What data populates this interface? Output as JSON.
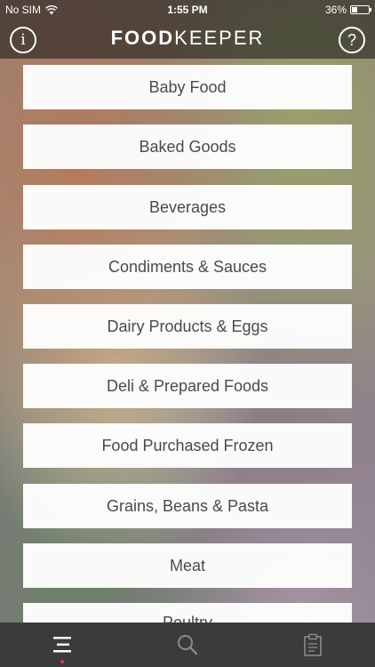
{
  "status_bar": {
    "carrier": "No SIM",
    "time": "1:55 PM",
    "battery": "36%",
    "battery_level": 0.36
  },
  "nav": {
    "logo_bold": "FOOD",
    "logo_light": "KEEPER",
    "info_icon": "info-icon",
    "help_icon": "help-icon"
  },
  "categories": [
    "Baby Food",
    "Baked Goods",
    "Beverages",
    "Condiments & Sauces",
    "Dairy Products & Eggs",
    "Deli & Prepared Foods",
    "Food Purchased Frozen",
    "Grains, Beans & Pasta",
    "Meat",
    "Poultry"
  ],
  "tab_bar": {
    "tabs": [
      {
        "icon": "categories-menu-icon",
        "active": true
      },
      {
        "icon": "search-icon",
        "active": false
      },
      {
        "icon": "clipboard-icon",
        "active": false
      }
    ],
    "accent_color": "#d9345a"
  }
}
